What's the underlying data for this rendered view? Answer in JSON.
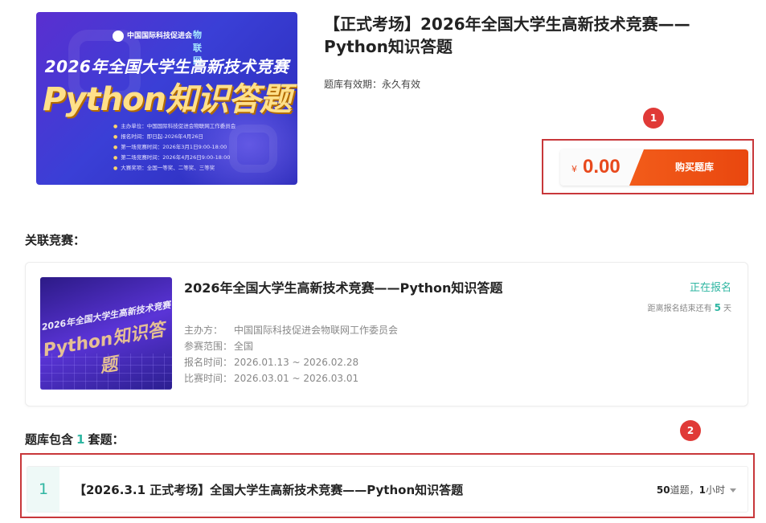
{
  "product": {
    "cover": {
      "org1": "中国国际科技促进会",
      "org2": "物联网",
      "title_line1": "2026年全国大学生高新技术竞赛",
      "title_line2": "Python知识答题",
      "info": [
        "主办单位：中国国际科技促进会物联网工作委员会",
        "报名时间：即日起-2026年4月26日",
        "第一场竞赛时间：2026年3月1日9:00-18:00",
        "第二场竞赛时间：2026年4月26日9:00-18:00",
        "大赛奖项：全国一等奖、二等奖、三等奖"
      ]
    },
    "title": "【正式考场】2026年全国大学生高新技术竞赛——Python知识答题",
    "validity_label": "题库有效期：",
    "validity_value": "永久有效",
    "currency_symbol": "¥",
    "price": "0.00",
    "buy_button": "购买题库"
  },
  "annotations": [
    "1",
    "2"
  ],
  "related": {
    "label": "关联竞赛：",
    "card": {
      "thumb_line1": "2026年全国大学生高新技术竞赛",
      "thumb_line2": "Python知识答题",
      "name": "2026年全国大学生高新技术竞赛——Python知识答题",
      "status": "正在报名",
      "remain_prefix": "距离报名结束还有",
      "remain_days": "5",
      "remain_suffix": "天",
      "rows": [
        {
          "key": "主办方：",
          "value": "中国国际科技促进会物联网工作委员会"
        },
        {
          "key": "参赛范围：",
          "value": "全国"
        },
        {
          "key": "报名时间：",
          "value": "2026.01.13 ~ 2026.02.28"
        },
        {
          "key": "比赛时间：",
          "value": "2026.03.01 ~ 2026.03.01"
        }
      ]
    }
  },
  "bank": {
    "label_prefix": "题库包含",
    "count": "1",
    "label_suffix": "套题：",
    "items": [
      {
        "index": "1",
        "title": "【2026.3.1 正式考场】全国大学生高新技术竞赛——Python知识答题",
        "questions": "50",
        "questions_unit": "道题，",
        "duration": "1",
        "duration_unit": "小时"
      }
    ]
  },
  "colors": {
    "accent_teal": "#2fb6a2",
    "price_orange": "#e8491d",
    "annotation_red": "#e03a37",
    "highlight_border": "#c8373a"
  }
}
